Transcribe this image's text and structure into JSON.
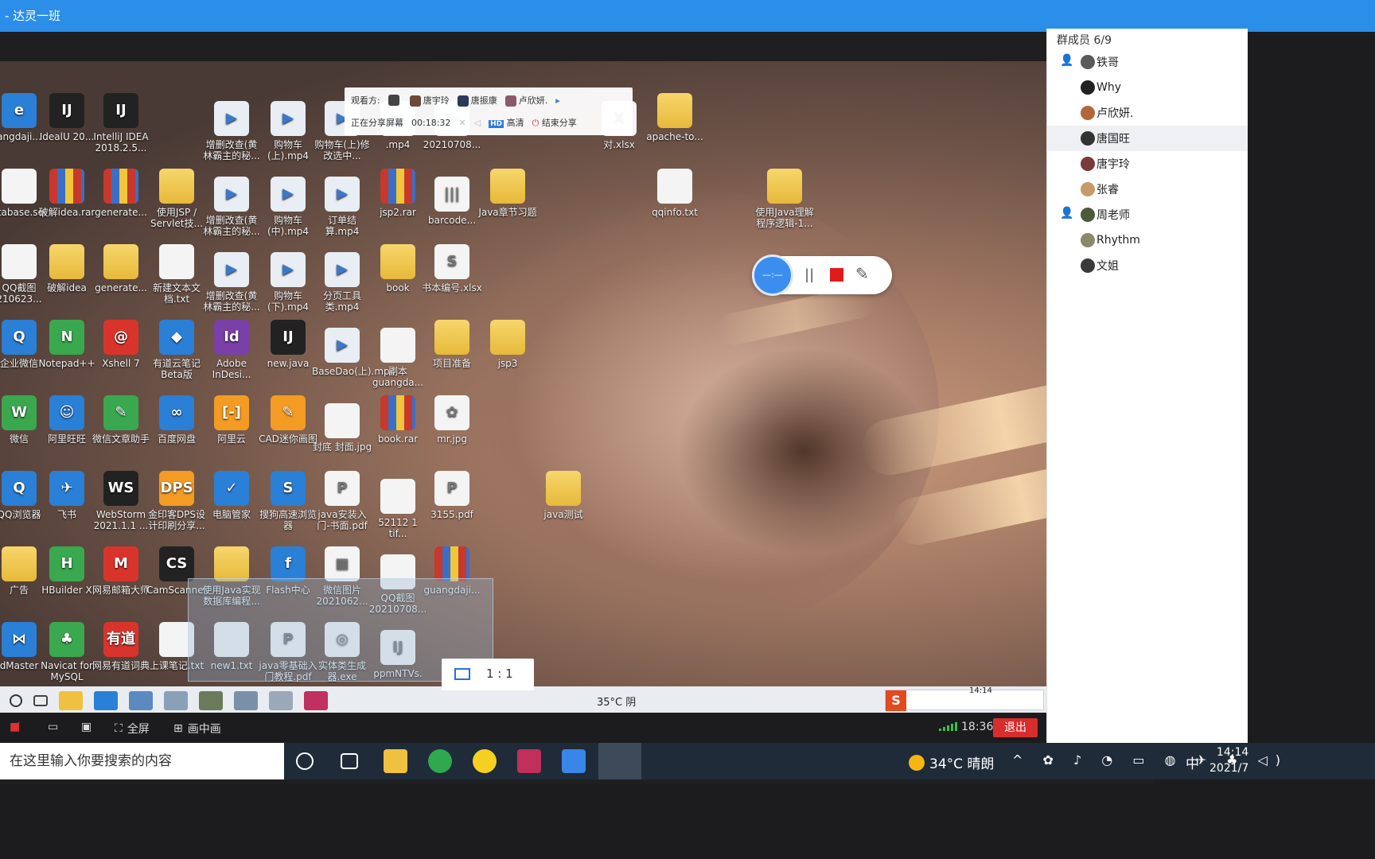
{
  "window": {
    "title": "- 达灵一班"
  },
  "share_bar": {
    "viewers_label": "观看方:",
    "viewers": [
      "唐宇玲",
      "唐振康",
      "卢欣妍."
    ],
    "status_label": "正在分享屏幕",
    "elapsed": "00:18:32",
    "hd_badge": "HD",
    "hd_label": "高清",
    "end_label": "结束分享"
  },
  "desktop_icons": [
    {
      "label": "angdaji...",
      "kind": "blue",
      "glyph": "e"
    },
    {
      "label": "IdealU 20...",
      "kind": "dark",
      "glyph": "IJ"
    },
    {
      "label": "IntelliJ IDEA 2018.2.5...",
      "kind": "dark",
      "glyph": "IJ"
    },
    {
      "label": "增删改查(黄林霸主的秘...",
      "kind": "vid",
      "glyph": "▶"
    },
    {
      "label": "购物车(上).mp4",
      "kind": "vid",
      "glyph": "▶"
    },
    {
      "label": "购物车(上)修改选中...",
      "kind": "vid",
      "glyph": "▶"
    },
    {
      "label": ".mp4",
      "kind": "vid",
      "glyph": "▶"
    },
    {
      "label": "20210708...",
      "kind": "vid",
      "glyph": "▶"
    },
    {
      "label": "对.xlsx",
      "kind": "doc",
      "glyph": "X"
    },
    {
      "label": "apache-to...",
      "kind": "folder",
      "glyph": ""
    },
    {
      "label": "atabase.sql",
      "kind": "doc",
      "glyph": ""
    },
    {
      "label": "破解idea.rar",
      "kind": "rar",
      "glyph": ""
    },
    {
      "label": "generate...",
      "kind": "rar",
      "glyph": ""
    },
    {
      "label": "使用JSP / Servlet技...",
      "kind": "folder",
      "glyph": ""
    },
    {
      "label": "增删改查(黄林霸主的秘...",
      "kind": "vid",
      "glyph": "▶"
    },
    {
      "label": "购物车(中).mp4",
      "kind": "vid",
      "glyph": "▶"
    },
    {
      "label": "订单结算.mp4",
      "kind": "vid",
      "glyph": "▶"
    },
    {
      "label": "jsp2.rar",
      "kind": "rar",
      "glyph": ""
    },
    {
      "label": "barcode...",
      "kind": "doc",
      "glyph": "|||"
    },
    {
      "label": "Java章节习题",
      "kind": "folder",
      "glyph": ""
    },
    {
      "label": "qqinfo.txt",
      "kind": "doc",
      "glyph": ""
    },
    {
      "label": "使用Java理解程序逻辑-1...",
      "kind": "folder",
      "glyph": ""
    },
    {
      "label": "QQ截图 210623...",
      "kind": "doc",
      "glyph": ""
    },
    {
      "label": "破解idea",
      "kind": "folder",
      "glyph": ""
    },
    {
      "label": "generate...",
      "kind": "folder",
      "glyph": ""
    },
    {
      "label": "新建文本文档.txt",
      "kind": "doc",
      "glyph": ""
    },
    {
      "label": "增删改查(黄林霸主的秘...",
      "kind": "vid",
      "glyph": "▶"
    },
    {
      "label": "购物车(下).mp4",
      "kind": "vid",
      "glyph": "▶"
    },
    {
      "label": "分页工具类.mp4",
      "kind": "vid",
      "glyph": "▶"
    },
    {
      "label": "book",
      "kind": "folder",
      "glyph": ""
    },
    {
      "label": "书本编号.xlsx",
      "kind": "doc",
      "glyph": "S"
    },
    {
      "label": "企业微信",
      "kind": "blue",
      "glyph": "Q"
    },
    {
      "label": "Notepad++",
      "kind": "green",
      "glyph": "N"
    },
    {
      "label": "Xshell 7",
      "kind": "red",
      "glyph": "@"
    },
    {
      "label": "有道云笔记 Beta版",
      "kind": "blue",
      "glyph": "◆"
    },
    {
      "label": "Adobe InDesi...",
      "kind": "purple",
      "glyph": "Id"
    },
    {
      "label": "new.java",
      "kind": "dark",
      "glyph": "IJ"
    },
    {
      "label": "BaseDao(上).mp4",
      "kind": "vid",
      "glyph": "▶"
    },
    {
      "label": "副本 guangda...",
      "kind": "doc",
      "glyph": ""
    },
    {
      "label": "项目准备",
      "kind": "folder",
      "glyph": ""
    },
    {
      "label": "jsp3",
      "kind": "folder",
      "glyph": ""
    },
    {
      "label": "微信",
      "kind": "green",
      "glyph": "W"
    },
    {
      "label": "阿里旺旺",
      "kind": "blue",
      "glyph": "☺"
    },
    {
      "label": "微信文章助手",
      "kind": "green",
      "glyph": "✎"
    },
    {
      "label": "百度网盘",
      "kind": "blue",
      "glyph": "∞"
    },
    {
      "label": "阿里云",
      "kind": "orange",
      "glyph": "[-]"
    },
    {
      "label": "CAD迷你画图",
      "kind": "orange",
      "glyph": "✎"
    },
    {
      "label": "封底 封面.jpg",
      "kind": "doc",
      "glyph": ""
    },
    {
      "label": "book.rar",
      "kind": "rar",
      "glyph": ""
    },
    {
      "label": "mr.jpg",
      "kind": "doc",
      "glyph": "✿"
    },
    {
      "label": "QQ浏览器",
      "kind": "blue",
      "glyph": "Q"
    },
    {
      "label": "飞书",
      "kind": "blue",
      "glyph": "✈"
    },
    {
      "label": "WebStorm 2021.1.1 ...",
      "kind": "dark",
      "glyph": "WS"
    },
    {
      "label": "金印客DPS设计印刷分享...",
      "kind": "orange",
      "glyph": "DPS"
    },
    {
      "label": "电脑管家",
      "kind": "blue",
      "glyph": "✓"
    },
    {
      "label": "搜狗高速浏览器",
      "kind": "blue",
      "glyph": "S"
    },
    {
      "label": "java安装入门-书面.pdf",
      "kind": "doc",
      "glyph": "P"
    },
    {
      "label": "52112 1 tif...",
      "kind": "doc",
      "glyph": ""
    },
    {
      "label": "3155.pdf",
      "kind": "doc",
      "glyph": "P"
    },
    {
      "label": "java测试",
      "kind": "folder",
      "glyph": ""
    },
    {
      "label": "广告",
      "kind": "folder",
      "glyph": ""
    },
    {
      "label": "HBuilder X",
      "kind": "green",
      "glyph": "H"
    },
    {
      "label": "网易邮箱大师",
      "kind": "red",
      "glyph": "M"
    },
    {
      "label": "CamScanner",
      "kind": "dark",
      "glyph": "CS"
    },
    {
      "label": "使用Java实现数据库编程...",
      "kind": "folder",
      "glyph": ""
    },
    {
      "label": "Flash中心",
      "kind": "blue",
      "glyph": "f"
    },
    {
      "label": "微信图片 2021062...",
      "kind": "doc",
      "glyph": "▦"
    },
    {
      "label": "QQ截图 20210708...",
      "kind": "doc",
      "glyph": ""
    },
    {
      "label": "guangdaji...",
      "kind": "rar",
      "glyph": ""
    },
    {
      "label": "dMaster",
      "kind": "blue",
      "glyph": "⋈"
    },
    {
      "label": "Navicat for MySQL",
      "kind": "green",
      "glyph": "♣"
    },
    {
      "label": "网易有道词典",
      "kind": "red",
      "glyph": "有道"
    },
    {
      "label": "上课笔记.txt",
      "kind": "doc",
      "glyph": ""
    },
    {
      "label": "new1.txt",
      "kind": "doc",
      "glyph": ""
    },
    {
      "label": "java零基础入门教程.pdf",
      "kind": "doc",
      "glyph": "P"
    },
    {
      "label": "实体类生成器.exe",
      "kind": "doc",
      "glyph": "◎"
    },
    {
      "label": "ppmNTVs.",
      "kind": "doc",
      "glyph": "IJ"
    }
  ],
  "record_widget": {
    "timer": "—:—",
    "pause_glyph": "||",
    "pen_glyph": "✎"
  },
  "shared_taskbar": {
    "weather": "35°C 阴",
    "time": "14:14"
  },
  "ratio_button": {
    "label": "1 : 1"
  },
  "bottom_bar": {
    "fullscreen_label": "全屏",
    "pip_label": "画中画",
    "duration": "18:36",
    "exit_label": "退出"
  },
  "members": {
    "header": "群成员 6/9",
    "list": [
      {
        "name": "铁哥",
        "host": true,
        "selected": false
      },
      {
        "name": "Why",
        "host": false,
        "selected": false
      },
      {
        "name": "卢欣妍.",
        "host": false,
        "selected": false
      },
      {
        "name": "唐国旺",
        "host": false,
        "selected": true
      },
      {
        "name": "唐宇玲",
        "host": false,
        "selected": false
      },
      {
        "name": "张睿",
        "host": false,
        "selected": false
      },
      {
        "name": "周老师",
        "host": true,
        "selected": false
      },
      {
        "name": "Rhythm",
        "host": false,
        "selected": false
      },
      {
        "name": "文姐",
        "host": false,
        "selected": false
      }
    ]
  },
  "os_taskbar": {
    "search_placeholder": "在这里输入你要搜索的内容",
    "weather": "34°C 晴朗",
    "ime": "中",
    "time": "14:14",
    "date": "2021/7"
  }
}
